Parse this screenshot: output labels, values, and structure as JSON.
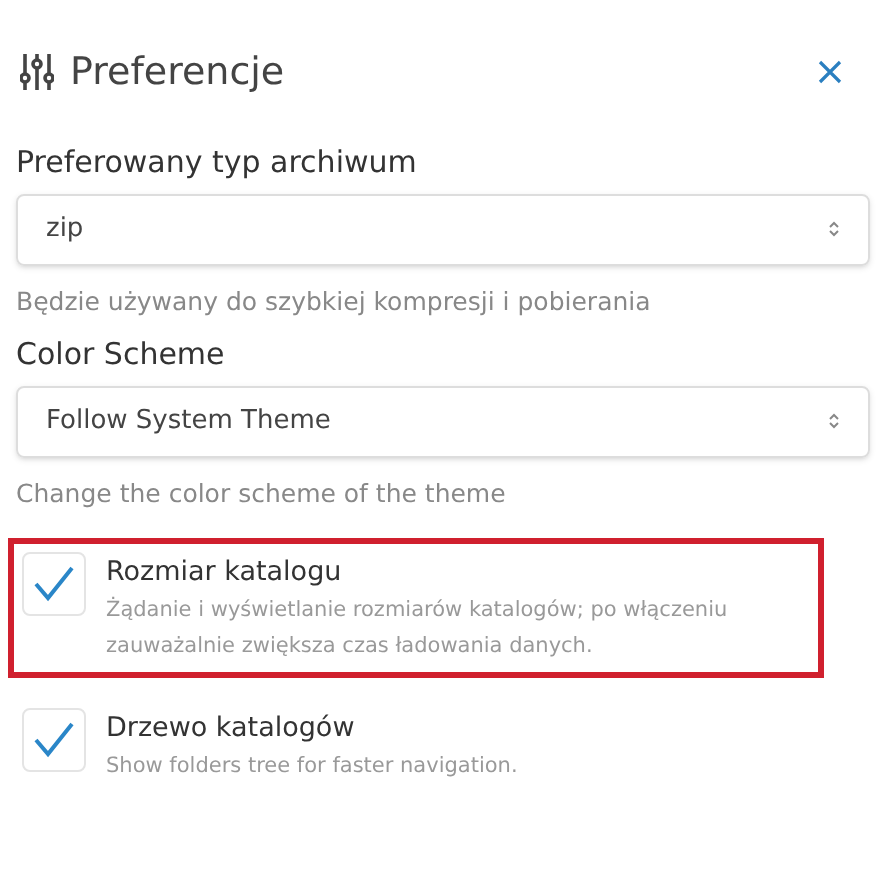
{
  "window": {
    "title": "Preferencje"
  },
  "selects": [
    {
      "label": "Preferowany typ archiwum",
      "value": "zip",
      "help": "Będzie używany do szybkiej kompresji i pobierania"
    },
    {
      "label": "Color Scheme",
      "value": "Follow System Theme",
      "help": "Change the color scheme of the theme"
    }
  ],
  "options": [
    {
      "title": "Rozmiar katalogu",
      "description": "Żądanie i wyświetlanie rozmiarów katalogów; po włączeniu zauważalnie zwiększa czas ładowania danych.",
      "checked": true,
      "highlighted": true
    },
    {
      "title": "Drzewo katalogów",
      "description": "Show folders tree for faster navigation.",
      "checked": true,
      "highlighted": false
    }
  ]
}
